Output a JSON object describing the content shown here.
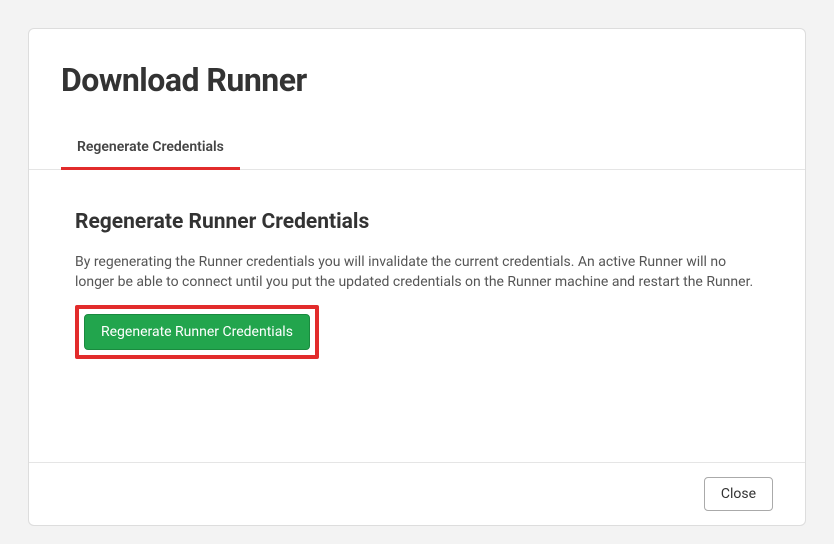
{
  "header": {
    "title": "Download Runner"
  },
  "tabs": [
    {
      "label": "Regenerate Credentials",
      "active": true
    }
  ],
  "section": {
    "title": "Regenerate Runner Credentials",
    "text": "By regenerating the Runner credentials you will invalidate the current credentials. An active Runner will no longer be able to connect until you put the updated credentials on the Runner machine and restart the Runner.",
    "button_label": "Regenerate Runner Credentials"
  },
  "footer": {
    "close_label": "Close"
  },
  "colors": {
    "accent_red": "#e22b2b",
    "accent_green": "#22a54d"
  }
}
